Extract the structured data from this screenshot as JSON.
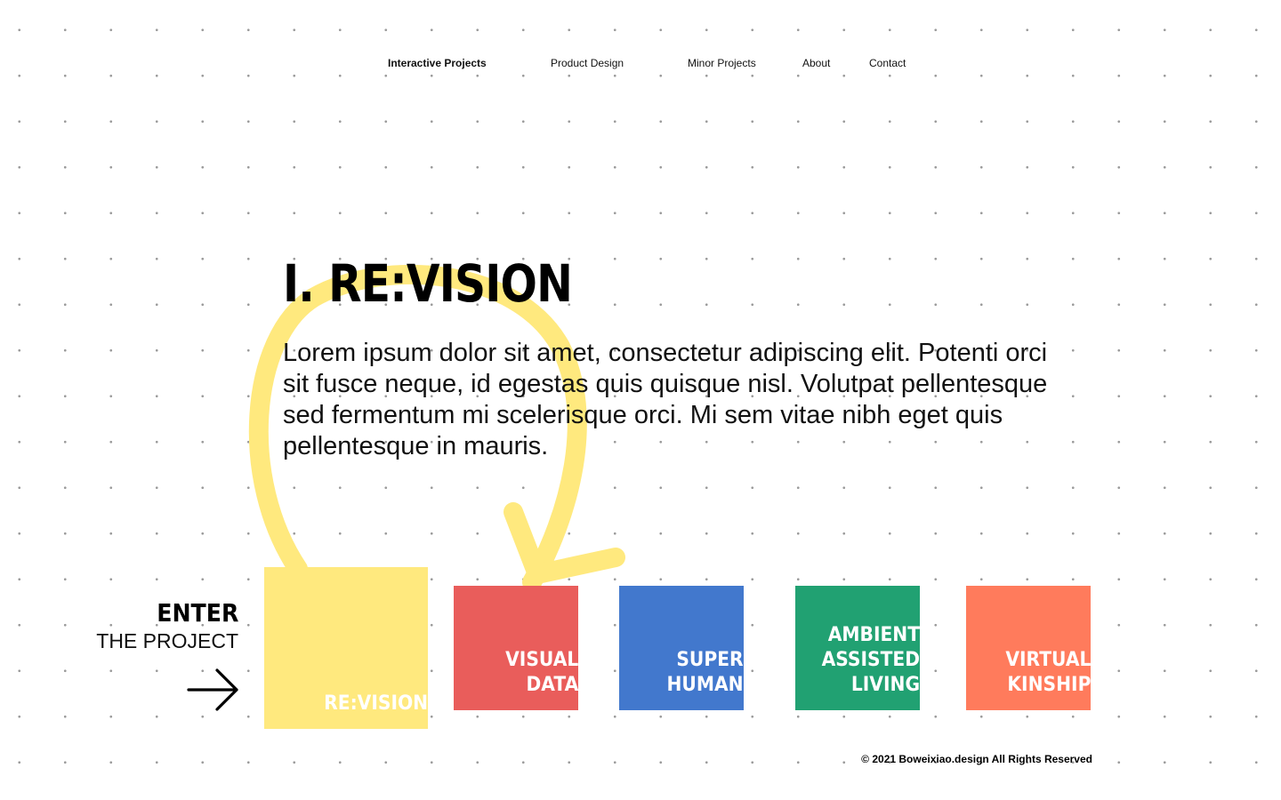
{
  "nav": {
    "items": [
      {
        "label": "Interactive Projects",
        "active": true
      },
      {
        "label": "Product Design",
        "active": false
      },
      {
        "label": "Minor Projects",
        "active": false
      },
      {
        "label": "About",
        "active": false
      },
      {
        "label": "Contact",
        "active": false
      }
    ]
  },
  "hero": {
    "title": "I. RE:VISION",
    "description": "Lorem ipsum dolor sit amet, consectetur adipiscing elit. Potenti orci sit fusce neque, id egestas quis quisque nisl. Volutpat pellentesque sed fermentum mi scelerisque orci. Mi sem vitae nibh eget quis pellentesque in mauris."
  },
  "enter": {
    "title": "ENTER",
    "subtitle": "THE PROJECT",
    "icon": "arrow-right-icon"
  },
  "projects": [
    {
      "label": "RE:VISION",
      "color": "#FFE97E",
      "selected": true
    },
    {
      "label": "VISUAL\nDATA",
      "color": "#E95D5B",
      "selected": false
    },
    {
      "label": "SUPER\nHUMAN",
      "color": "#4278CD",
      "selected": false
    },
    {
      "label": "AMBIENT\nASSISTED\nLIVING",
      "color": "#21A172",
      "selected": false
    },
    {
      "label": "VIRTUAL\nKINSHIP",
      "color": "#FF7B5C",
      "selected": false
    }
  ],
  "decoration": {
    "icon": "loop-arrow-icon",
    "color": "#FFE97E"
  },
  "footer": {
    "copyright": "© 2021 Boweixiao.design All Rights Reserved"
  }
}
